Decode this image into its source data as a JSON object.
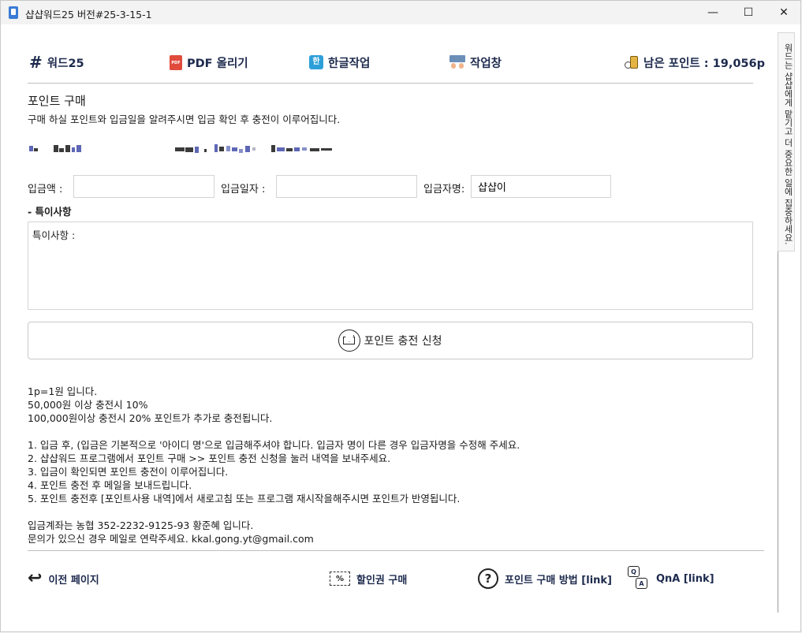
{
  "window": {
    "title": "샵샵워드25  버전#25-3-15-1",
    "minimize_glyph": "—",
    "maximize_glyph": "☐",
    "close_glyph": "✕"
  },
  "toolbar": {
    "words_label": "워드25",
    "pdf_label": "PDF 올리기",
    "pdf_icon_text": "PDF",
    "hangul_label": "한글작업",
    "hangul_icon_text": "한",
    "work_label": "작업창",
    "points_label": "남은 포인트 : 19,056p"
  },
  "page": {
    "title": "포인트 구매",
    "description": "구매 하실 포인트와 입금일을 알려주시면 입금 확인 후 충전이 이루어집니다."
  },
  "form": {
    "amount_label": "입금액 :",
    "amount_value": "",
    "date_label": "입금일자 :",
    "date_value": "",
    "depositor_label": "입금자명:",
    "depositor_value": "샵샵이",
    "notes_heading": "- 특이사항",
    "notes_value": "특이사항 :",
    "submit_label": "포인트 충전 신청"
  },
  "info": {
    "rates": [
      "1p=1원 입니다.",
      "50,000원 이상 충전시 10%",
      "100,000원이상 충전시 20% 포인트가 추가로 충전됩니다."
    ],
    "steps": [
      "1. 입금 후, (입금은 기본적으로 '아이디 명'으로 입금해주셔야 합니다. 입금자 명이 다른 경우 입금자명을 수정해 주세요.",
      "2. 샵샵워드 프로그램에서 포인트 구매 >> 포인트 충전 신청을 눌러 내역을 보내주세요.",
      "3. 입금이 확인되면 포인트 충전이 이루어집니다.",
      "4. 포인트 충전 후 메일을 보내드립니다.",
      "5. 포인트 충전후 [포인트사용 내역]에서 새로고침 또는 프로그램 재시작을해주시면 포인트가 반영됩니다."
    ],
    "contact": [
      "입금계좌는 농협 352-2232-9125-93 황준혜 입니다.",
      "문의가 있으신 경우 메일로 연락주세요. kkal.gong.yt@gmail.com"
    ]
  },
  "bottom_nav": {
    "prev_label": "이전 페이지",
    "coupon_label": "할인권 구매",
    "coupon_icon_text": "%",
    "howto_label": "포인트 구매 방법 [link]",
    "howto_icon_text": "?",
    "qna_label": "QnA [link]",
    "qna_icon_q": "Q",
    "qna_icon_a": "A"
  },
  "side_panel": {
    "text": "워드는 샵샵에게 맡기고 더 중요한 일에 집중하세요."
  },
  "colors": {
    "accent_navy": "#1d2a4d",
    "pdf_red": "#e04b3c",
    "hangul_blue": "#2d9fd8"
  }
}
